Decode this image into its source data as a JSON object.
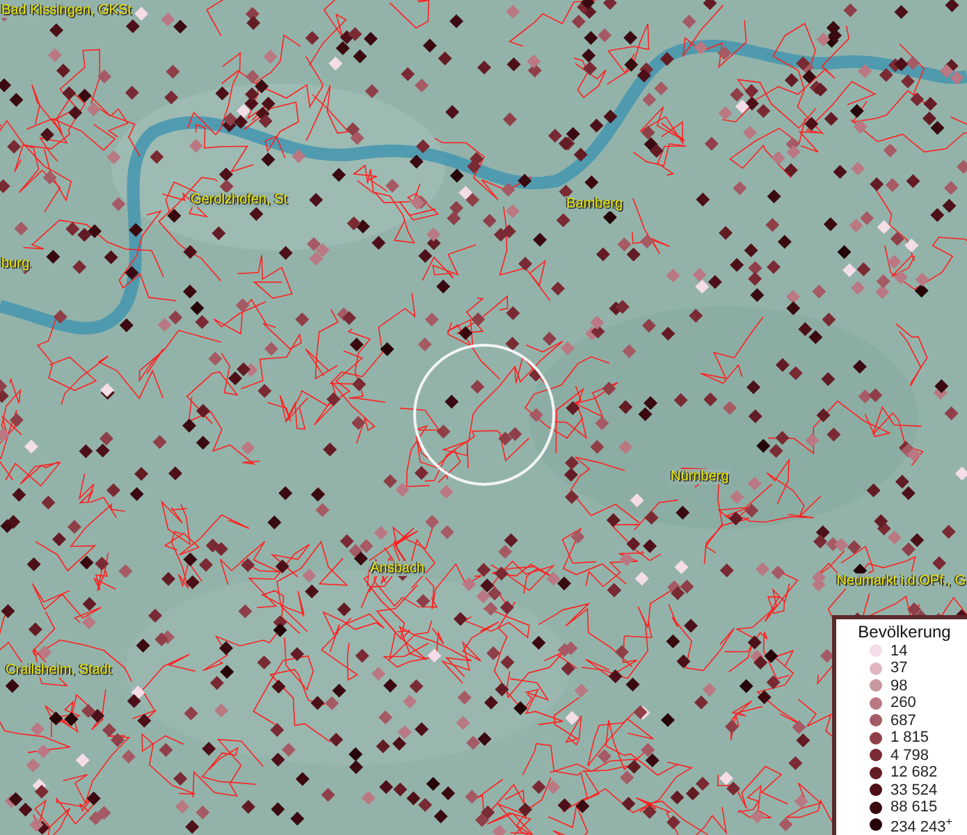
{
  "map": {
    "places": [
      {
        "name": "Bad Kissingen, GKSt"
      },
      {
        "name": "Gerolzhofen, St"
      },
      {
        "name": "Bamberg"
      },
      {
        "name": "burg"
      },
      {
        "name": "Nürnberg"
      },
      {
        "name": "Ansbach"
      },
      {
        "name": "Neumarkt i.d.OPf., G"
      },
      {
        "name": "Crailsheim, Stadt"
      }
    ]
  },
  "legend": {
    "title": "Bevölkerung",
    "items": [
      {
        "label": "14",
        "color": "#f5dde8"
      },
      {
        "label": "37",
        "color": "#e0b5c0"
      },
      {
        "label": "98",
        "color": "#c9969e"
      },
      {
        "label": "260",
        "color": "#b97882"
      },
      {
        "label": "687",
        "color": "#a55a64"
      },
      {
        "label": "1 815",
        "color": "#8f3f48"
      },
      {
        "label": "4 798",
        "color": "#7a2a33"
      },
      {
        "label": "12 682",
        "color": "#641c24"
      },
      {
        "label": "33 524",
        "color": "#4e1018"
      },
      {
        "label": "88 615",
        "color": "#3a0a10"
      },
      {
        "label": "234 243$^{+}$",
        "color": "#260508"
      }
    ]
  }
}
